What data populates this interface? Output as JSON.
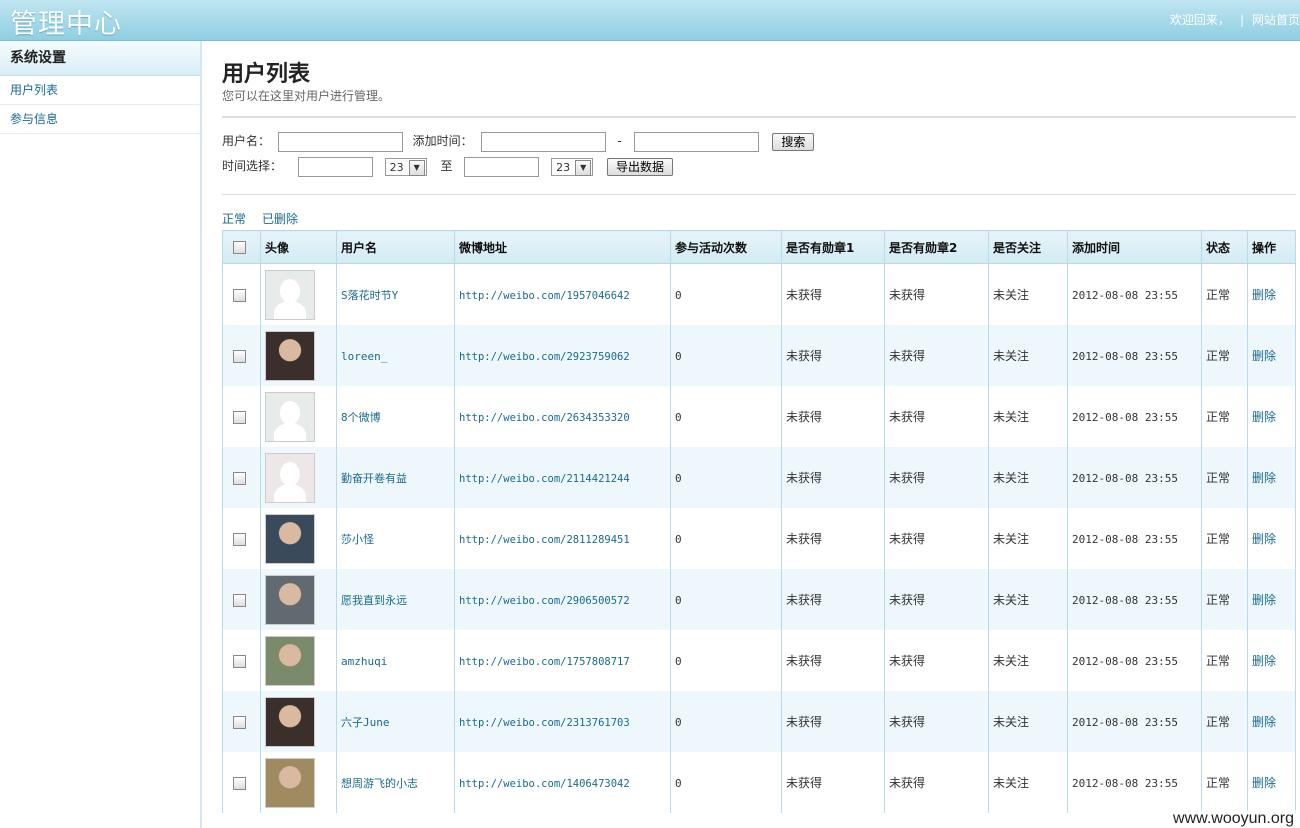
{
  "header": {
    "logo": "管理中心",
    "welcome": "欢迎回来，",
    "sep": "|",
    "home_link": "网站首页"
  },
  "sidebar": {
    "title": "系统设置",
    "items": [
      {
        "label": "用户列表"
      },
      {
        "label": "参与信息"
      }
    ]
  },
  "page": {
    "title": "用户列表",
    "subtitle": "您可以在这里对用户进行管理。"
  },
  "filters": {
    "username_label": "用户名：",
    "username_value": "",
    "addtime_label": "添加时间：",
    "addtime_from": "",
    "dash": "-",
    "addtime_to": "",
    "search_button": "搜索",
    "time_label": "时间选择：",
    "time_from": "",
    "hour_from": "23",
    "to_label": "至",
    "time_to": "",
    "hour_to": "23",
    "export_button": "导出数据"
  },
  "status_tabs": [
    "正常",
    "已删除"
  ],
  "table": {
    "headers": [
      "",
      "头像",
      "用户名",
      "微博地址",
      "参与活动次数",
      "是否有勋章1",
      "是否有勋章2",
      "是否关注",
      "添加时间",
      "状态",
      "操作"
    ],
    "rows": [
      {
        "avatar": "placeholder-male-avatar",
        "username": "S落花时节Y",
        "url": "http://weibo.com/1957046642",
        "count": "0",
        "medal1": "未获得",
        "medal2": "未获得",
        "follow": "未关注",
        "time": "2012-08-08 23:55",
        "status": "正常",
        "action": "删除"
      },
      {
        "avatar": "photo-avatar",
        "username": "loreen_",
        "url": "http://weibo.com/2923759062",
        "count": "0",
        "medal1": "未获得",
        "medal2": "未获得",
        "follow": "未关注",
        "time": "2012-08-08 23:55",
        "status": "正常",
        "action": "删除"
      },
      {
        "avatar": "placeholder-male-avatar",
        "username": "8个微博",
        "url": "http://weibo.com/2634353320",
        "count": "0",
        "medal1": "未获得",
        "medal2": "未获得",
        "follow": "未关注",
        "time": "2012-08-08 23:55",
        "status": "正常",
        "action": "删除"
      },
      {
        "avatar": "placeholder-female-avatar",
        "username": "勤奋开卷有益",
        "url": "http://weibo.com/2114421244",
        "count": "0",
        "medal1": "未获得",
        "medal2": "未获得",
        "follow": "未关注",
        "time": "2012-08-08 23:55",
        "status": "正常",
        "action": "删除"
      },
      {
        "avatar": "photo-avatar",
        "username": "莎小怪",
        "url": "http://weibo.com/2811289451",
        "count": "0",
        "medal1": "未获得",
        "medal2": "未获得",
        "follow": "未关注",
        "time": "2012-08-08 23:55",
        "status": "正常",
        "action": "删除"
      },
      {
        "avatar": "photo-avatar",
        "username": "愿我直到永远",
        "url": "http://weibo.com/2906500572",
        "count": "0",
        "medal1": "未获得",
        "medal2": "未获得",
        "follow": "未关注",
        "time": "2012-08-08 23:55",
        "status": "正常",
        "action": "删除"
      },
      {
        "avatar": "photo-avatar",
        "username": "amzhuqi",
        "url": "http://weibo.com/1757808717",
        "count": "0",
        "medal1": "未获得",
        "medal2": "未获得",
        "follow": "未关注",
        "time": "2012-08-08 23:55",
        "status": "正常",
        "action": "删除"
      },
      {
        "avatar": "photo-avatar",
        "username": "六子June",
        "url": "http://weibo.com/2313761703",
        "count": "0",
        "medal1": "未获得",
        "medal2": "未获得",
        "follow": "未关注",
        "time": "2012-08-08 23:55",
        "status": "正常",
        "action": "删除"
      },
      {
        "avatar": "photo-avatar",
        "username": "想周游飞的小志",
        "url": "http://weibo.com/1406473042",
        "count": "0",
        "medal1": "未获得",
        "medal2": "未获得",
        "follow": "未关注",
        "time": "2012-08-08 23:55",
        "status": "正常",
        "action": "删除"
      }
    ]
  },
  "watermark": "www.wooyun.org",
  "colors": {
    "header_bg": "#9fd6e8",
    "link": "#1a6a8a",
    "row_alt": "#eef8fc",
    "border": "#b9dbe8"
  }
}
